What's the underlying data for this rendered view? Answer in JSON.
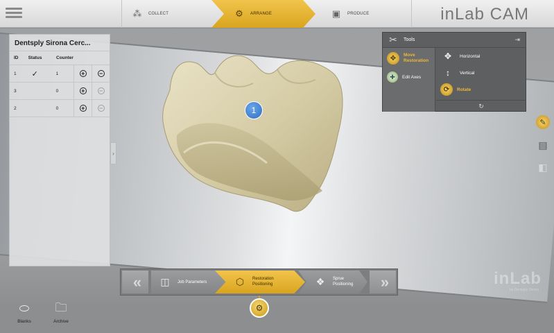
{
  "topbar": {
    "steps": [
      {
        "label": "COLLECT",
        "icon": "collect-icon",
        "active": false
      },
      {
        "label": "ARRANGE",
        "icon": "arrange-icon",
        "active": true
      },
      {
        "label": "PRODUCE",
        "icon": "produce-icon",
        "active": false
      }
    ],
    "brand": "inLab CAM"
  },
  "restoration_list": {
    "title": "Dentsply Sirona Cerc...",
    "columns": [
      "ID",
      "Status",
      "Counter"
    ],
    "rows": [
      {
        "id": "1",
        "status": "✓",
        "counter": "1",
        "minus_enabled": true
      },
      {
        "id": "3",
        "status": "",
        "counter": "0",
        "minus_enabled": false
      },
      {
        "id": "2",
        "status": "",
        "counter": "0",
        "minus_enabled": false
      }
    ]
  },
  "viewport": {
    "restoration_badge": "1"
  },
  "tools": {
    "title": "Tools",
    "left_items": [
      {
        "label": "Move\nRestoration",
        "active": true
      },
      {
        "label": "Edit Axes",
        "active": false
      }
    ],
    "right_items": [
      {
        "label": "Horizontal",
        "active": false
      },
      {
        "label": "Vertical",
        "active": false
      },
      {
        "label": "Rotate",
        "active": true
      }
    ]
  },
  "bottom_nav": {
    "steps": [
      {
        "label": "Job Parameters",
        "active": false
      },
      {
        "label": "Restoration\nPositioning",
        "active": true
      },
      {
        "label": "Sprue\nPositioning",
        "active": false
      }
    ]
  },
  "bottom_left": {
    "blanks": "Blanks",
    "archive": "Archive"
  },
  "watermark": {
    "logo": "inLab",
    "sub": "by Dentsply Sirona"
  },
  "colors": {
    "accent": "#e2b02e",
    "topbar": "#e4e4e4",
    "panel_dark": "#5d5f61",
    "badge": "#3b7fd0"
  }
}
